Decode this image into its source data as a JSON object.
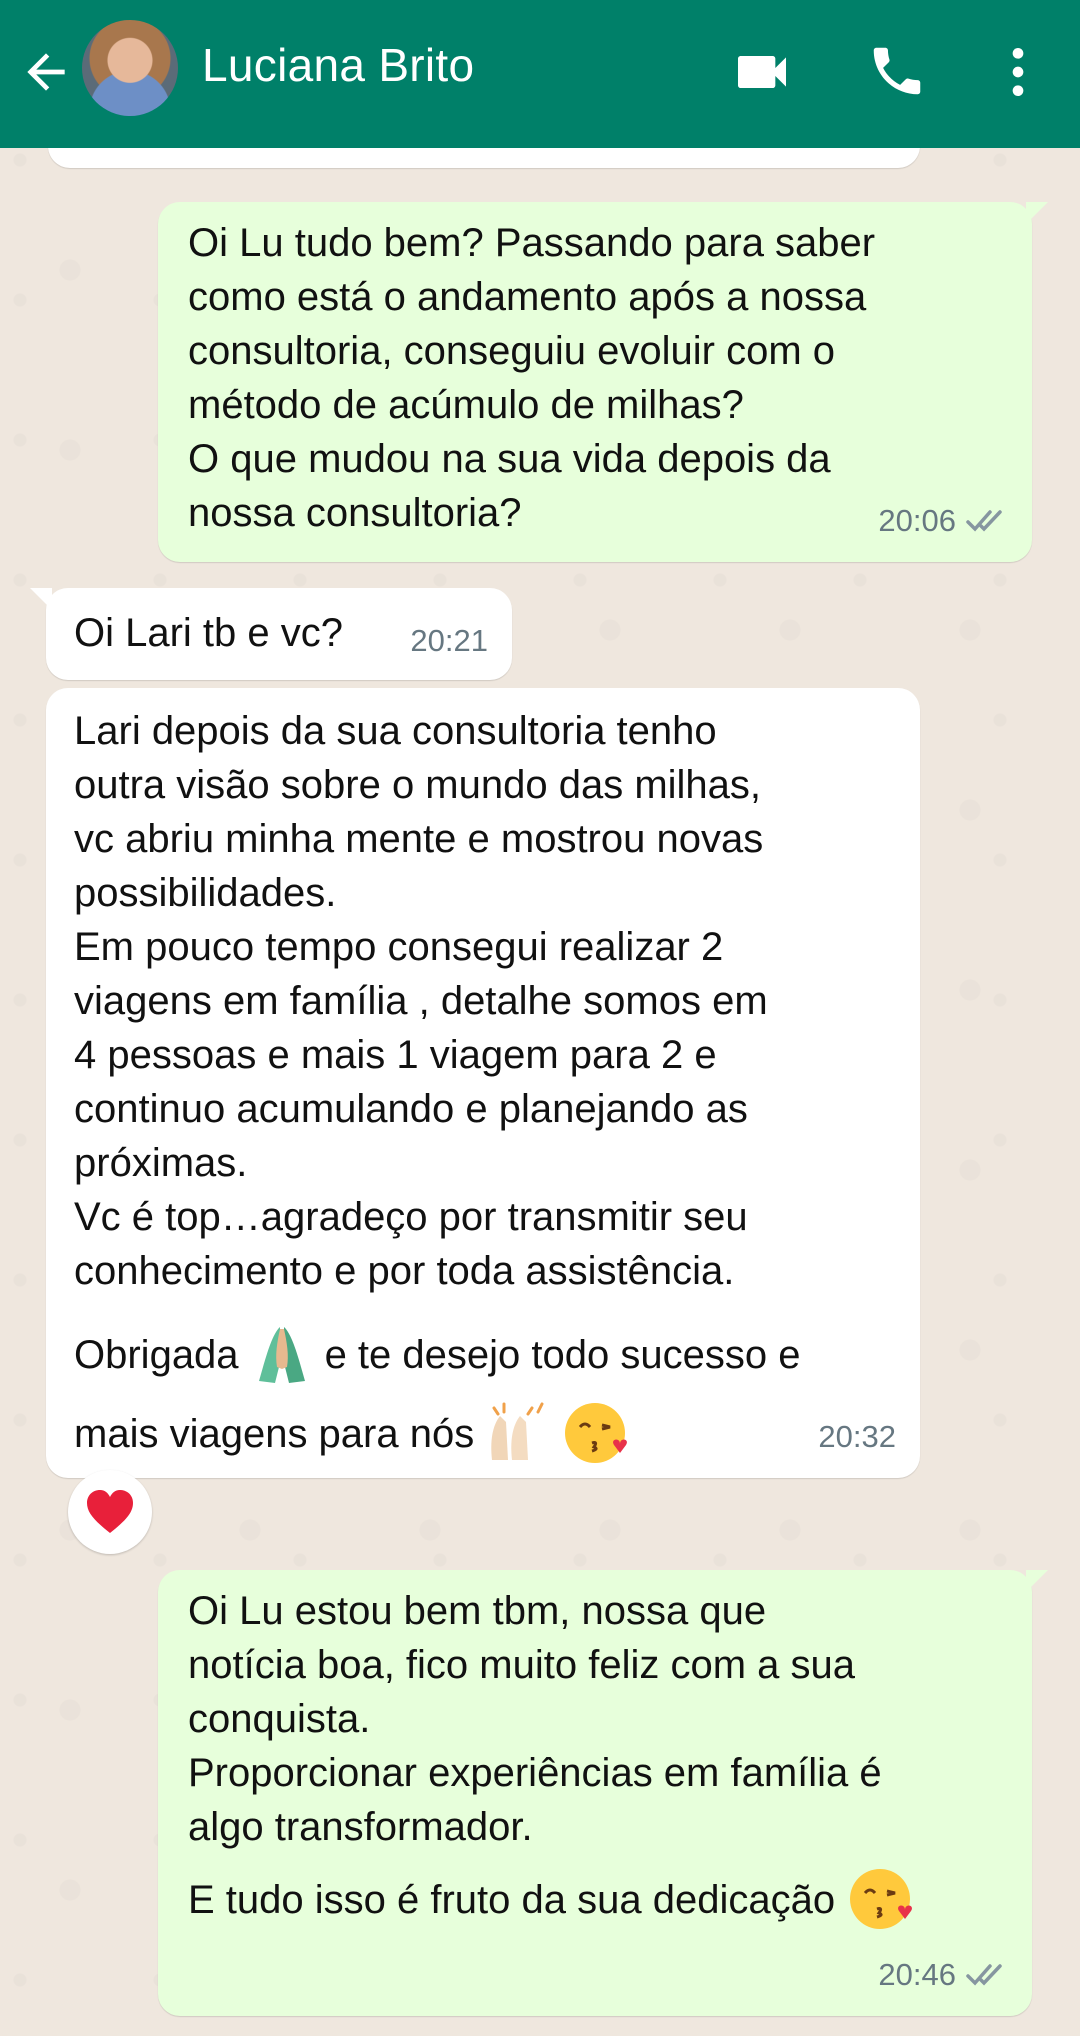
{
  "header": {
    "contact_name": "Luciana Brito",
    "back_icon": "arrow-left-icon",
    "video_icon": "video-camera-icon",
    "call_icon": "phone-icon",
    "menu_icon": "more-vertical-icon",
    "bar_color": "#008069"
  },
  "messages": [
    {
      "direction": "outgoing",
      "text": "Oi Lu tudo bem? Passando para saber\ncomo está o andamento após a nossa\nconsultoria, conseguiu evoluir com o\nmétodo de acúmulo de milhas?\nO que mudou na sua vida depois da\nnossa consultoria?",
      "time": "20:06",
      "status": "read-double-check"
    },
    {
      "direction": "incoming",
      "text": "Oi Lari tb e vc?",
      "time": "20:21"
    },
    {
      "direction": "incoming",
      "text": "Lari depois da sua consultoria tenho\noutra visão sobre o mundo das milhas,\nvc abriu minha mente e mostrou novas\npossibilidades.\nEm pouco tempo consegui realizar  2\nviagens em família , detalhe somos em\n4 pessoas e mais 1 viagem para 2 e\ncontinuo acumulando e planejando as\npróximas.\nVc é top…agradeço por transmitir seu\nconhecimento e por toda assistência.",
      "text_line2_a": "Obrigada",
      "text_line2_b": "e te desejo todo sucesso e",
      "text_line3": "mais viagens para nós",
      "time": "20:32",
      "reaction": "red-heart"
    },
    {
      "direction": "outgoing",
      "text": "Oi Lu estou bem tbm, nossa que\nnotícia boa, fico muito feliz com a sua\nconquista.\nProporcionar experiências em família é\nalgo transformador.",
      "text_last": "E tudo isso é fruto da sua dedicação",
      "time": "20:46",
      "status": "read-double-check"
    }
  ],
  "colors": {
    "outgoing_bubble": "#e7ffdb",
    "incoming_bubble": "#ffffff",
    "background": "#efe7de",
    "timestamp": "#667781"
  }
}
